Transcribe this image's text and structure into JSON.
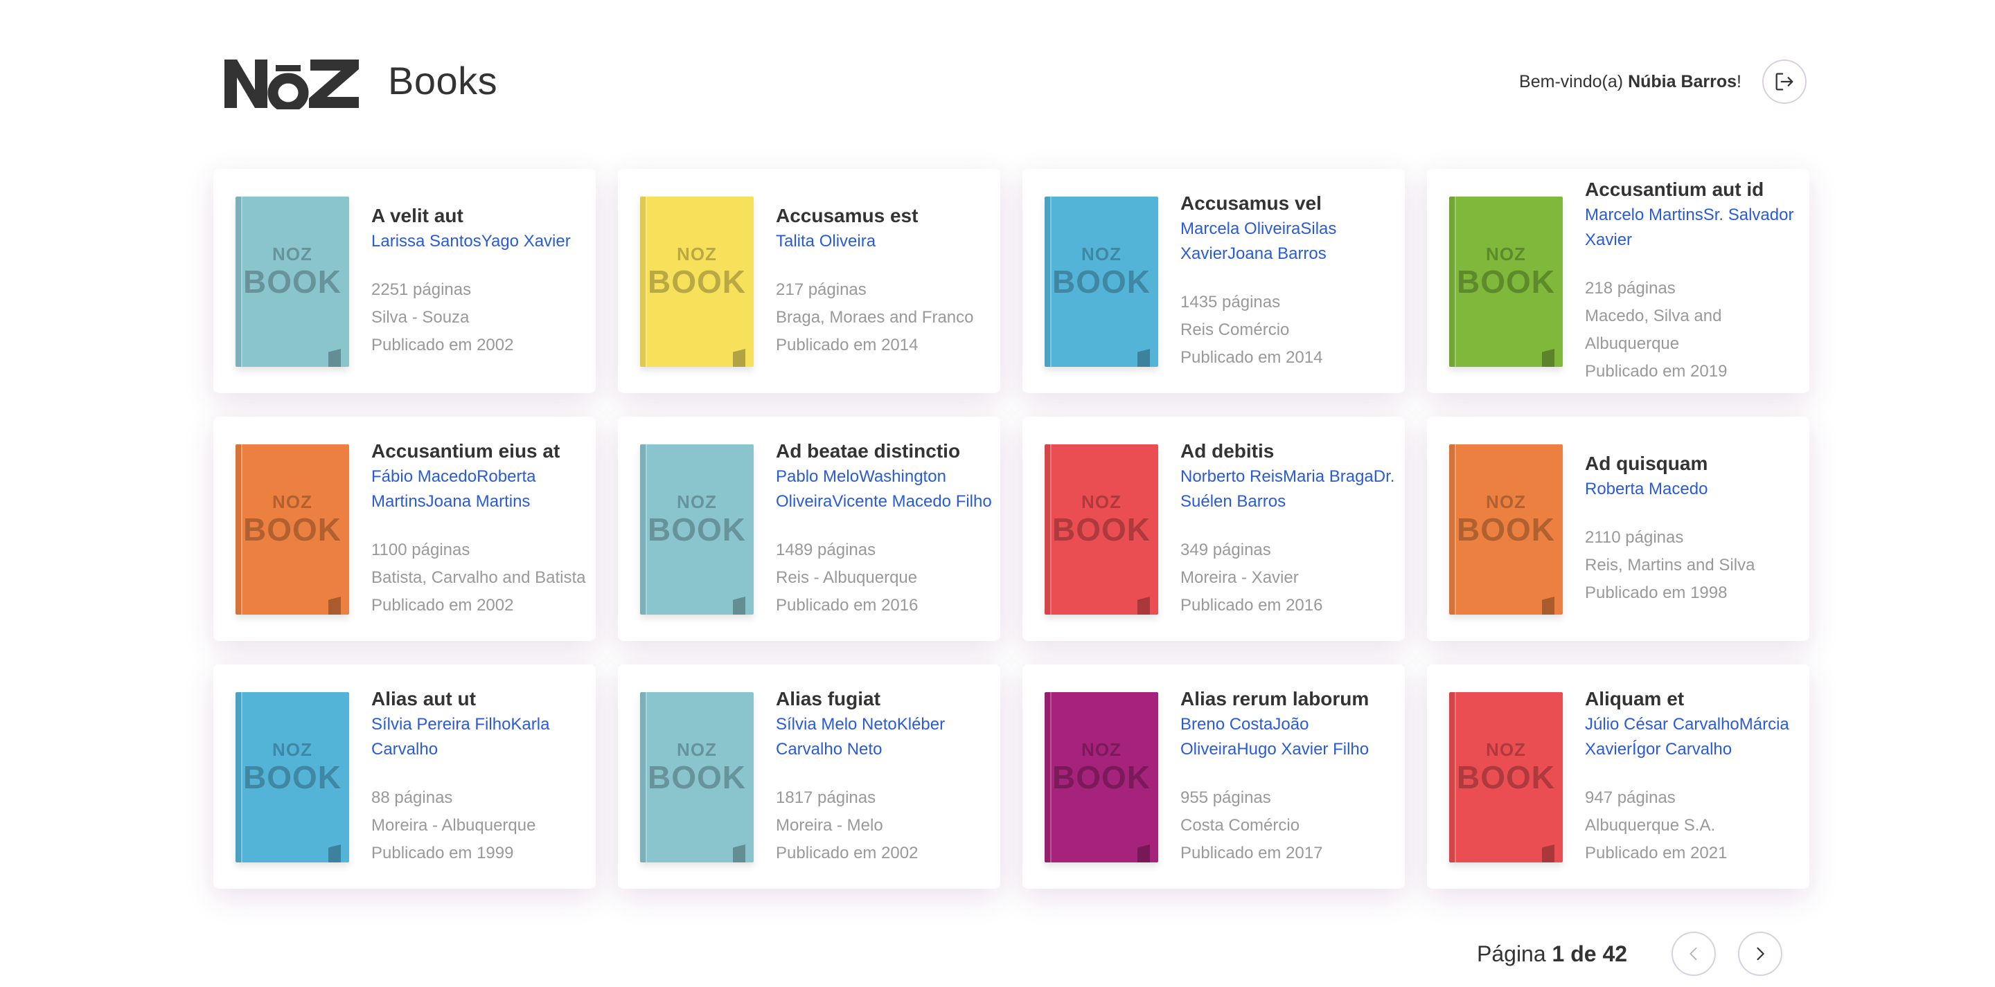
{
  "header": {
    "logo_text": "NOZ",
    "title": "Books",
    "welcome_prefix": "Bem-vindo(a)",
    "user_name": "Núbia Barros",
    "welcome_suffix": "!",
    "logout_icon": "logout-icon"
  },
  "cover_text": {
    "brand": "NOZ",
    "label": "BOOK"
  },
  "books": [
    {
      "title": "A velit aut",
      "authors": "Larissa SantosYago Xavier",
      "pages": "2251 páginas",
      "publisher": "Silva - Souza",
      "published": "Publicado em 2002",
      "color": "#8AC5CE"
    },
    {
      "title": "Accusamus est",
      "authors": "Talita Oliveira",
      "pages": "217 páginas",
      "publisher": "Braga, Moraes and Franco",
      "published": "Publicado em 2014",
      "color": "#F7E15B"
    },
    {
      "title": "Accusamus vel",
      "authors": "Marcela OliveiraSilas XavierJoana Barros",
      "pages": "1435 páginas",
      "publisher": "Reis Comércio",
      "published": "Publicado em 2014",
      "color": "#54B4D8"
    },
    {
      "title": "Accusantium aut id",
      "authors": "Marcelo MartinsSr. Salvador Xavier",
      "pages": "218 páginas",
      "publisher": "Macedo, Silva and Albuquerque",
      "published": "Publicado em 2019",
      "color": "#7FB83B"
    },
    {
      "title": "Accusantium eius at",
      "authors": "Fábio MacedoRoberta MartinsJoana Martins",
      "pages": "1100 páginas",
      "publisher": "Batista, Carvalho and Batista",
      "published": "Publicado em 2002",
      "color": "#EC8041"
    },
    {
      "title": "Ad beatae distinctio",
      "authors": "Pablo MeloWashington OliveiraVicente Macedo Filho",
      "pages": "1489 páginas",
      "publisher": "Reis - Albuquerque",
      "published": "Publicado em 2016",
      "color": "#8AC5CE"
    },
    {
      "title": "Ad debitis",
      "authors": "Norberto ReisMaria BragaDr. Suélen Barros",
      "pages": "349 páginas",
      "publisher": "Moreira - Xavier",
      "published": "Publicado em 2016",
      "color": "#EA4E52"
    },
    {
      "title": "Ad quisquam",
      "authors": "Roberta Macedo",
      "pages": "2110 páginas",
      "publisher": "Reis, Martins and Silva",
      "published": "Publicado em 1998",
      "color": "#EC8041"
    },
    {
      "title": "Alias aut ut",
      "authors": "Sílvia Pereira FilhoKarla Carvalho",
      "pages": "88 páginas",
      "publisher": "Moreira - Albuquerque",
      "published": "Publicado em 1999",
      "color": "#54B4D8"
    },
    {
      "title": "Alias fugiat",
      "authors": "Sílvia Melo NetoKléber Carvalho Neto",
      "pages": "1817 páginas",
      "publisher": "Moreira - Melo",
      "published": "Publicado em 2002",
      "color": "#8AC5CE"
    },
    {
      "title": "Alias rerum laborum",
      "authors": "Breno CostaJoão OliveiraHugo Xavier Filho",
      "pages": "955 páginas",
      "publisher": "Costa Comércio",
      "published": "Publicado em 2017",
      "color": "#A5237A"
    },
    {
      "title": "Aliquam et",
      "authors": "Júlio César CarvalhoMárcia XavierÍgor Carvalho",
      "pages": "947 páginas",
      "publisher": "Albuquerque S.A.",
      "published": "Publicado em 2021",
      "color": "#EA4E52"
    }
  ],
  "pagination": {
    "prefix": "Página",
    "current": "1",
    "separator": "de",
    "total": "42",
    "prev_icon": "chevron-left-icon",
    "next_icon": "chevron-right-icon"
  }
}
